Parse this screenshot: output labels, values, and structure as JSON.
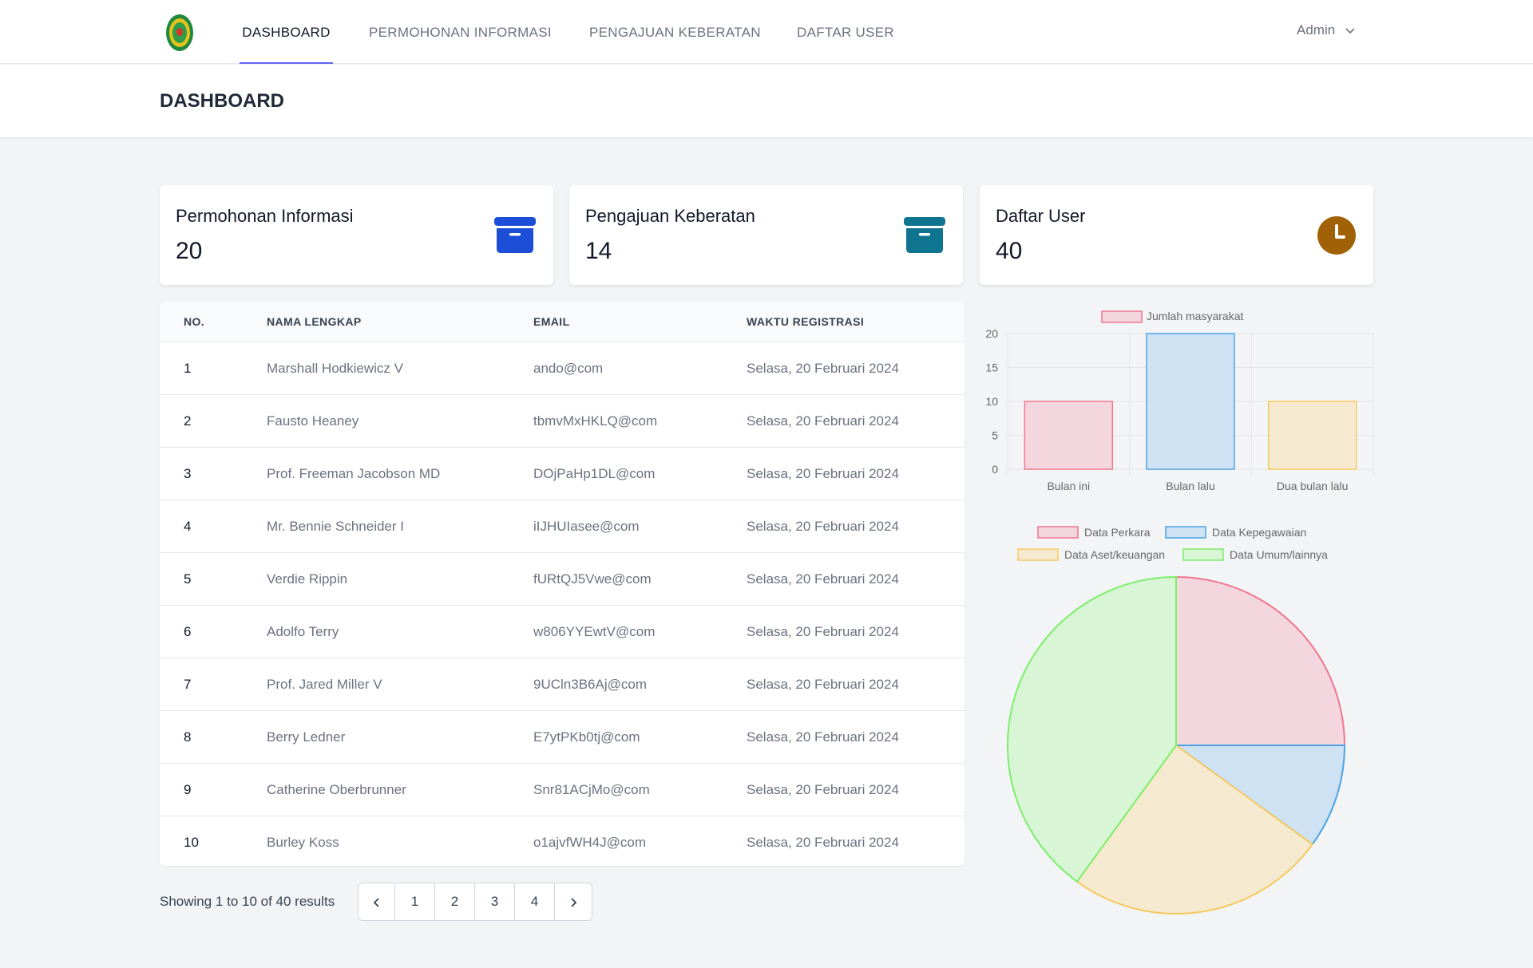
{
  "nav": {
    "items": [
      {
        "label": "DASHBOARD",
        "active": true
      },
      {
        "label": "PERMOHONAN INFORMASI",
        "active": false
      },
      {
        "label": "PENGAJUAN KEBERATAN",
        "active": false
      },
      {
        "label": "DAFTAR USER",
        "active": false
      }
    ],
    "user": "Admin"
  },
  "header": {
    "title": "DASHBOARD"
  },
  "cards": [
    {
      "label": "Permohonan Informasi",
      "value": "20",
      "icon": "archive-icon",
      "color": "#1d4ed8"
    },
    {
      "label": "Pengajuan Keberatan",
      "value": "14",
      "icon": "archive-icon",
      "color": "#0e7490"
    },
    {
      "label": "Daftar User",
      "value": "40",
      "icon": "clock-icon",
      "color": "#a16207"
    }
  ],
  "table": {
    "headers": [
      "NO.",
      "NAMA LENGKAP",
      "EMAIL",
      "WAKTU REGISTRASI"
    ],
    "rows": [
      {
        "no": "1",
        "name": "Marshall Hodkiewicz V",
        "email": "ando@com",
        "time": "Selasa, 20 Februari 2024"
      },
      {
        "no": "2",
        "name": "Fausto Heaney",
        "email": "tbmvMxHKLQ@com",
        "time": "Selasa, 20 Februari 2024"
      },
      {
        "no": "3",
        "name": "Prof. Freeman Jacobson MD",
        "email": "DOjPaHp1DL@com",
        "time": "Selasa, 20 Februari 2024"
      },
      {
        "no": "4",
        "name": "Mr. Bennie Schneider I",
        "email": "iIJHUIasee@com",
        "time": "Selasa, 20 Februari 2024"
      },
      {
        "no": "5",
        "name": "Verdie Rippin",
        "email": "fURtQJ5Vwe@com",
        "time": "Selasa, 20 Februari 2024"
      },
      {
        "no": "6",
        "name": "Adolfo Terry",
        "email": "w806YYEwtV@com",
        "time": "Selasa, 20 Februari 2024"
      },
      {
        "no": "7",
        "name": "Prof. Jared Miller V",
        "email": "9UCln3B6Aj@com",
        "time": "Selasa, 20 Februari 2024"
      },
      {
        "no": "8",
        "name": "Berry Ledner",
        "email": "E7ytPKb0tj@com",
        "time": "Selasa, 20 Februari 2024"
      },
      {
        "no": "9",
        "name": "Catherine Oberbrunner",
        "email": "Snr81ACjMo@com",
        "time": "Selasa, 20 Februari 2024"
      },
      {
        "no": "10",
        "name": "Burley Koss",
        "email": "o1ajvfWH4J@com",
        "time": "Selasa, 20 Februari 2024"
      }
    ]
  },
  "pagination": {
    "showing": "Showing 1 to 10 of 40 results",
    "pages": [
      "1",
      "2",
      "3",
      "4"
    ]
  },
  "chart_data": [
    {
      "type": "bar",
      "categories": [
        "Bulan ini",
        "Bulan lalu",
        "Dua bulan lalu"
      ],
      "series": [
        {
          "name": "Jumlah masyarakat",
          "values": [
            10,
            20,
            10
          ]
        }
      ],
      "colors_fill": [
        "#f4d6df",
        "#cfe2f3",
        "#f5ead0"
      ],
      "colors_stroke": [
        "#f0768f",
        "#4aa3e6",
        "#f5c95f"
      ],
      "ylim": [
        0,
        20
      ],
      "yticks": [
        0,
        5,
        10,
        15,
        20
      ],
      "legend": "top"
    },
    {
      "type": "pie",
      "labels": [
        "Data Perkara",
        "Data Kepegawaian",
        "Data Aset/keuangan",
        "Data Umum/lainnya"
      ],
      "values": [
        25,
        10,
        25,
        40
      ],
      "colors_fill": [
        "#f4d6df",
        "#cfe2f3",
        "#f5ead0",
        "#d8f5d6"
      ],
      "colors_stroke": [
        "#f0768f",
        "#4aa3e6",
        "#f5c95f",
        "#7dee6a"
      ],
      "legend": "top"
    }
  ]
}
